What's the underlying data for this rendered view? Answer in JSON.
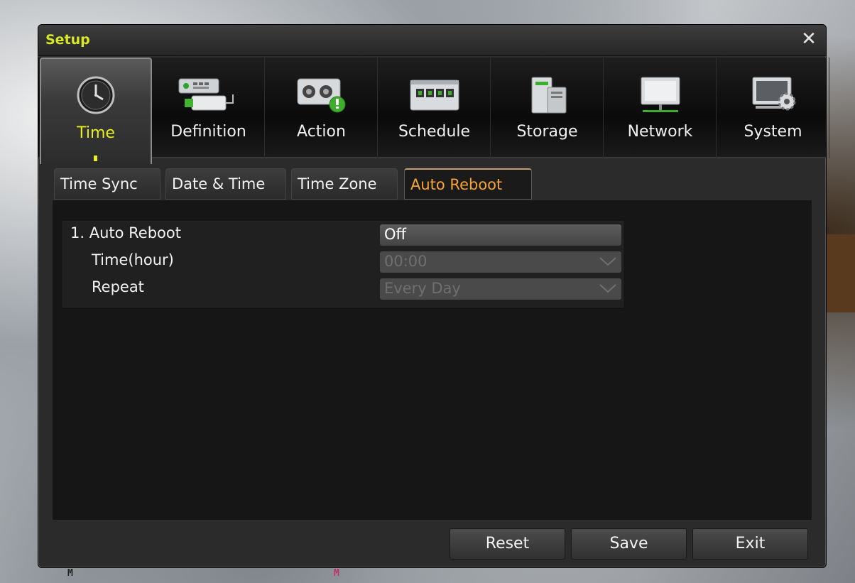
{
  "background": {
    "badges": [
      "M",
      "M"
    ]
  },
  "window": {
    "title": "Setup"
  },
  "menu": {
    "items": [
      {
        "label": "Time",
        "icon": "clock-icon",
        "active": true
      },
      {
        "label": "Definition",
        "icon": "device-definition-icon"
      },
      {
        "label": "Action",
        "icon": "action-alert-icon"
      },
      {
        "label": "Schedule",
        "icon": "calendar-icon"
      },
      {
        "label": "Storage",
        "icon": "storage-icon"
      },
      {
        "label": "Network",
        "icon": "monitor-network-icon"
      },
      {
        "label": "System",
        "icon": "system-gear-icon"
      }
    ]
  },
  "subtabs": {
    "items": [
      {
        "label": "Time Sync"
      },
      {
        "label": "Date & Time"
      },
      {
        "label": "Time Zone"
      },
      {
        "label": "Auto Reboot",
        "active": true
      }
    ]
  },
  "settings": {
    "auto_reboot": {
      "label": "1. Auto Reboot",
      "value": "Off"
    },
    "time_hour": {
      "label": "Time(hour)",
      "value": "00:00"
    },
    "repeat": {
      "label": "Repeat",
      "value": "Every Day"
    }
  },
  "buttons": {
    "reset": "Reset",
    "save": "Save",
    "exit": "Exit"
  },
  "colors": {
    "title": "#d8e826",
    "active_tab": "#e7f01d",
    "active_subtab": "#f7a531"
  }
}
